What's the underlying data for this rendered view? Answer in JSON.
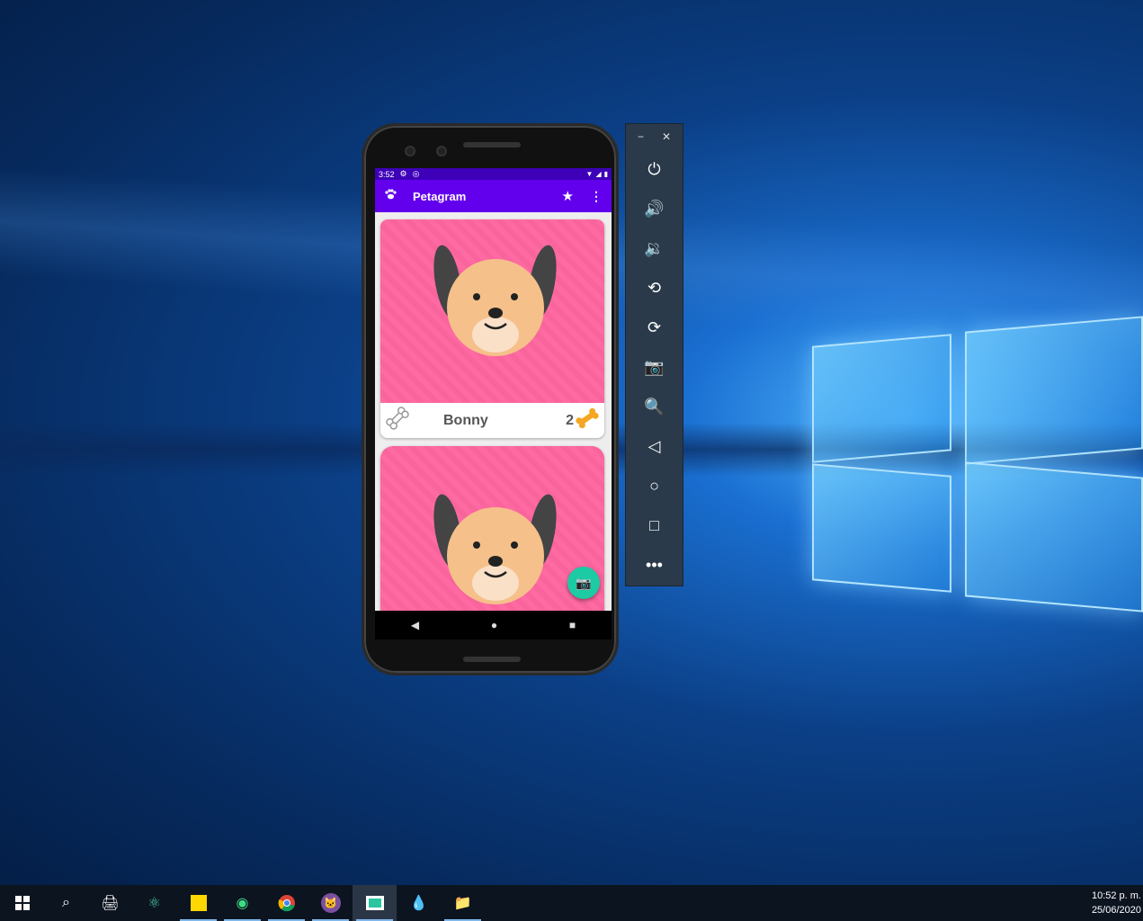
{
  "app": {
    "status_time": "3:52",
    "title": "Petagram",
    "menu_icon": "⋮"
  },
  "pets": [
    {
      "name": "Bonny",
      "likes": "2"
    },
    {
      "name": "",
      "likes": ""
    }
  ],
  "toolbar": {
    "minimize": "−",
    "close": "✕",
    "buttons": [
      "power",
      "volume-up",
      "volume-down",
      "rotate-left",
      "rotate-right",
      "screenshot",
      "zoom",
      "back",
      "home",
      "overview",
      "more"
    ]
  },
  "taskbar": {
    "time": "10:52 p. m.",
    "date": "25/06/2020"
  },
  "colors": {
    "status_bar": "#3d00b8",
    "app_bar": "#6200ee",
    "pet_bg": "#ff6aa2",
    "fab": "#1ccba4",
    "toolbar_bg": "#2b3a4a",
    "taskbar_bg": "#0c1420"
  }
}
